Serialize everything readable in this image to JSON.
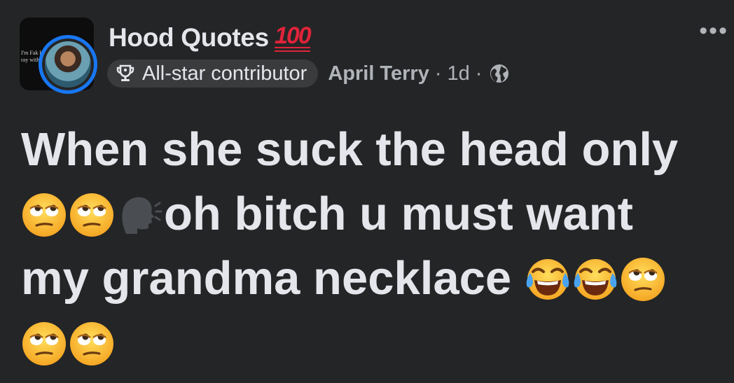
{
  "post": {
    "group_name": "Hood Quotes",
    "group_emoji": "100",
    "badge_label": "All-star contributor",
    "author": "April Terry",
    "separator": "·",
    "time": "1d",
    "more_label": "•••",
    "thumb_text_1": "I'm Fak H",
    "thumb_text_2": "ray with",
    "text_lines": [
      "When she suck the head only",
      "oh bitch u must want",
      "my grandma necklace"
    ]
  },
  "icons": {
    "more": "more-options-icon",
    "trophy": "trophy-icon",
    "globe": "globe-icon",
    "emoji_rolling_eyes": "face-with-rolling-eyes-icon",
    "emoji_speaking_head": "speaking-head-icon",
    "emoji_tears_of_joy": "face-with-tears-of-joy-icon"
  },
  "colors": {
    "background": "#242526",
    "text_primary": "#e4e6eb",
    "text_secondary": "#b0b3b8",
    "badge_bg": "#3a3b3c",
    "avatar_ring": "#1877f2",
    "hundred_red": "#e0243a"
  }
}
